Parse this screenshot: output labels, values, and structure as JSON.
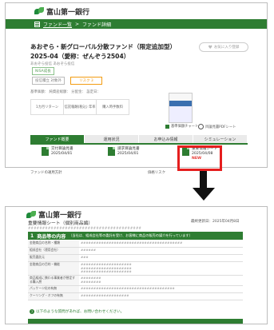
{
  "brand": {
    "name": "富山第一銀行"
  },
  "top": {
    "breadcrumb": {
      "link": "ファンド一覧",
      "separator": ">",
      "current": "ファンド詳細"
    },
    "fund_title": "あおぞら・新グローバル分散ファンド（限定追加型）2025-04（愛称：ぜんぞう2504）",
    "fund_subtitle": "あおぞら投信 あおぞら投信",
    "favorite_label": "お気に入り登録",
    "tags": {
      "green": "NISA成長",
      "gray": "投信積立 対象外",
      "orange": "リスク 3"
    },
    "info_line": "基準価額：   純資産総額：   分配金：   設定日：",
    "stat_boxes": [
      "1カ月リターン",
      "信託報酬(税込)  年率",
      "購入時手数料"
    ],
    "chart_link": "基準価額チャート",
    "pdf_link": "目論見書PDFシート",
    "tabs": [
      "ファンド概要",
      "運用状況",
      "お申込み情報",
      "シミュレーション"
    ],
    "reports": [
      {
        "title": "交付目論見書",
        "date": "2025/04/01",
        "is_new": false
      },
      {
        "title": "請求目論見書",
        "date": "2025/04/01",
        "is_new": false
      },
      {
        "title": "重要情報シート",
        "date": "2025/04/08",
        "is_new": true,
        "new_label": "NEW"
      }
    ],
    "footer_left": "ファンドの運用方針",
    "footer_mid": "価格リスク"
  },
  "bottom": {
    "header_title": "重要情報シート（個別商品編）",
    "date_text": "最終更新日：2025年04月8日",
    "hash_line": "########################################",
    "section": {
      "number": "1",
      "title": "商品等の内容",
      "note": "（当社は、組成会社等の委託を受け、お客様に商品の販売の媒介を行っています）"
    },
    "rows": [
      {
        "label": "金融商品の名称・種類",
        "value": "########################################"
      },
      {
        "label": "組成会社（運用会社）",
        "value": "######"
      },
      {
        "label": "販売委託元",
        "value": "###"
      },
      {
        "label": "金融商品の目的・機能",
        "value": "####################\n####################\n####################"
      },
      {
        "label": "商品組成に携わる事業者が想定する購入層",
        "value": "########\n########"
      },
      {
        "label": "パッケージ化の有無",
        "value": "#####################################"
      },
      {
        "label": "クーリング・オフの有無",
        "value": "###################"
      }
    ],
    "question_note": "以下のような質問があれば、お問い合わせください。"
  }
}
